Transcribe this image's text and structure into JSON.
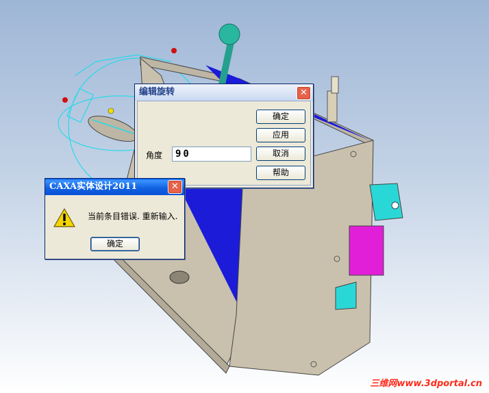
{
  "rotate_dialog": {
    "title": "编辑旋转",
    "angle_label": "角度",
    "angle_value": "90",
    "buttons": {
      "ok": "确定",
      "apply": "应用",
      "cancel": "取消",
      "help": "帮助"
    },
    "close_glyph": "✕"
  },
  "error_dialog": {
    "title": "CAXA实体设计2011",
    "message": "当前条目错误. 重新输入.",
    "ok": "确定",
    "close_glyph": "✕",
    "icon": "warning-icon"
  },
  "watermark": "三维网www.3dportal.cn",
  "colors": {
    "part_body": "#c9c1ad",
    "blue_face": "#1b1bd8",
    "handle_teal": "#26a08e",
    "magenta_block": "#e21fd8",
    "cyan_block": "#2ad7d7",
    "rotation_guide": "#29d9e8"
  }
}
